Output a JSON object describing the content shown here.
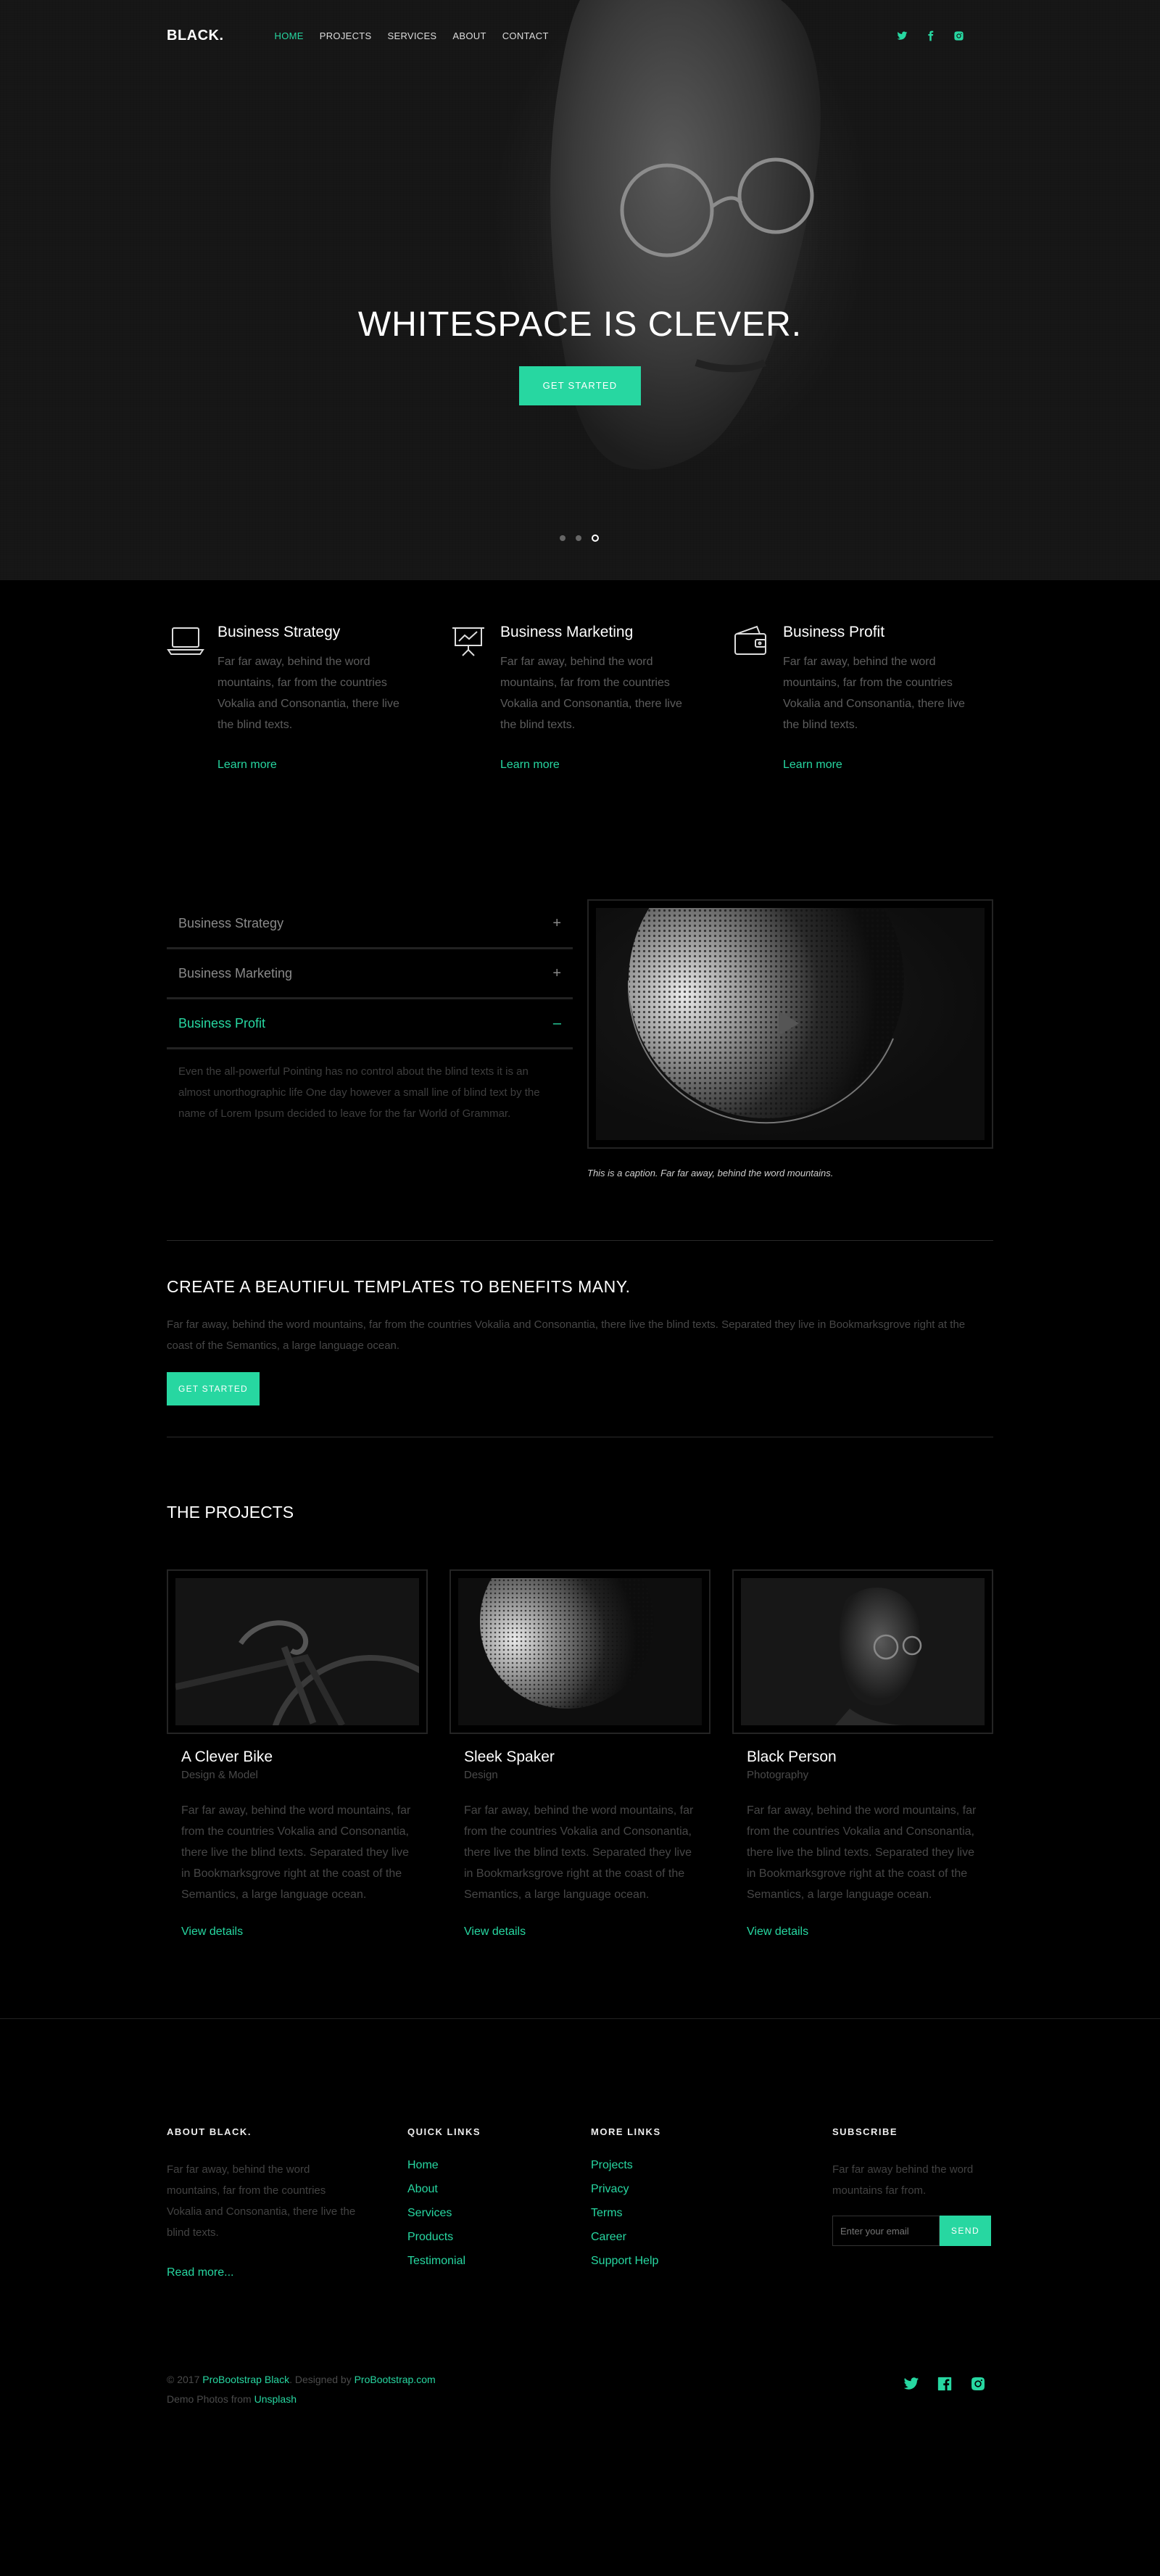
{
  "nav": {
    "brand": "BLACK.",
    "items": [
      {
        "label": "HOME",
        "active": true
      },
      {
        "label": "PROJECTS"
      },
      {
        "label": "SERVICES"
      },
      {
        "label": "ABOUT"
      },
      {
        "label": "CONTACT"
      }
    ],
    "social": [
      "twitter-icon",
      "facebook-icon",
      "instagram-icon"
    ]
  },
  "hero": {
    "title": "WHITESPACE IS CLEVER.",
    "button": "GET STARTED",
    "slides": 3,
    "active_slide": 3
  },
  "features": [
    {
      "icon": "laptop-icon",
      "title": "Business Strategy",
      "text": "Far far away, behind the word mountains, far from the countries Vokalia and Consonantia, there live the blind texts.",
      "link": "Learn more"
    },
    {
      "icon": "presentation-icon",
      "title": "Business Marketing",
      "text": "Far far away, behind the word mountains, far from the countries Vokalia and Consonantia, there live the blind texts.",
      "link": "Learn more"
    },
    {
      "icon": "wallet-icon",
      "title": "Business Profit",
      "text": "Far far away, behind the word mountains, far from the countries Vokalia and Consonantia, there live the blind texts.",
      "link": "Learn more"
    }
  ],
  "accordion": {
    "items": [
      {
        "label": "Business Strategy",
        "sign": "+"
      },
      {
        "label": "Business Marketing",
        "sign": "+"
      },
      {
        "label": "Business Profit",
        "sign": "–"
      }
    ],
    "open_text": "Even the all-powerful Pointing has no control about the blind texts it is an almost unorthographic life One day however a small line of blind text by the name of Lorem Ipsum decided to leave for the far World of Grammar."
  },
  "video": {
    "caption": "This is a caption. Far far away, behind the word mountains."
  },
  "cta": {
    "title": "CREATE A BEAUTIFUL TEMPLATES TO BENEFITS MANY.",
    "text": "Far far away, behind the word mountains, far from the countries Vokalia and Consonantia, there live the blind texts. Separated they live in Bookmarksgrove right at the coast of the Semantics, a large language ocean.",
    "button": "GET STARTED"
  },
  "projects": {
    "title": "THE PROJECTS",
    "items": [
      {
        "title": "A Clever Bike",
        "category": "Design & Model",
        "text": "Far far away, behind the word mountains, far from the countries Vokalia and Consonantia, there live the blind texts. Separated they live in Bookmarksgrove right at the coast of the Semantics, a large language ocean.",
        "link": "View details"
      },
      {
        "title": "Sleek Spaker",
        "category": "Design",
        "text": "Far far away, behind the word mountains, far from the countries Vokalia and Consonantia, there live the blind texts. Separated they live in Bookmarksgrove right at the coast of the Semantics, a large language ocean.",
        "link": "View details"
      },
      {
        "title": "Black Person",
        "category": "Photography",
        "text": "Far far away, behind the word mountains, far from the countries Vokalia and Consonantia, there live the blind texts. Separated they live in Bookmarksgrove right at the coast of the Semantics, a large language ocean.",
        "link": "View details"
      }
    ]
  },
  "footer": {
    "about": {
      "title": "ABOUT BLACK.",
      "text": "Far far away, behind the word mountains, far from the countries Vokalia and Consonantia, there live the blind texts.",
      "link": "Read more..."
    },
    "quick": {
      "title": "QUICK LINKS",
      "links": [
        "Home",
        "About",
        "Services",
        "Products",
        "Testimonial"
      ]
    },
    "more": {
      "title": "MORE LINKS",
      "links": [
        "Projects",
        "Privacy",
        "Terms",
        "Career",
        "Support Help"
      ]
    },
    "subscribe": {
      "title": "SUBSCRIBE",
      "text": "Far far away behind the word mountains far from.",
      "placeholder": "Enter your email",
      "button": "SEND"
    },
    "copyright": {
      "prefix": "© 2017 ",
      "brand_link": "ProBootstrap Black",
      "middle": ". Designed by ",
      "designer_link": "ProBootstrap.com",
      "photos_prefix": "Demo Photos from ",
      "photos_link": "Unsplash"
    },
    "social": [
      "twitter-icon",
      "facebook-icon",
      "instagram-icon"
    ]
  },
  "colors": {
    "accent": "#27d7a1",
    "background": "#000000"
  }
}
